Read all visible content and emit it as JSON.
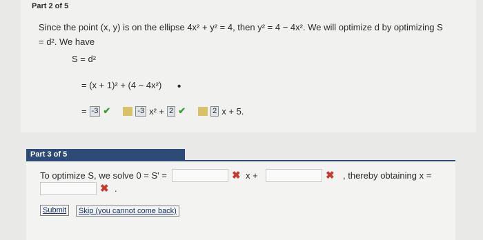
{
  "part2": {
    "header": "Part 2 of 5",
    "text_line1": "Since the point (x, y) is on the ellipse 4x² + y² = 4, then y² = 4 − 4x². We will optimize d by optimizing S",
    "text_line2": "= d². We have",
    "eq_S": "S = d²",
    "eq_line2": "= (x + 1)² + (4 − 4x²)",
    "eq3_prefix": "=",
    "ans1": "-3",
    "ans2": "-3",
    "ans2_suffix": "x² +",
    "ans3": "2",
    "ans4": "2",
    "ans4_suffix": "x + 5."
  },
  "part3": {
    "header": "Part 3 of 5",
    "prompt_before": "To optimize S, we solve 0 = S' =",
    "prompt_mid": "x +",
    "prompt_after": ", thereby obtaining x =",
    "dot": ".",
    "input1_value": "",
    "input2_value": "",
    "input3_value": ""
  },
  "buttons": {
    "submit": "Submit",
    "skip": "Skip (you cannot come back)"
  },
  "colors": {
    "header_blue": "#2d4b76",
    "check_green": "#3b9a3b",
    "error_red": "#c8382c",
    "hint_gold": "#d9c266"
  }
}
